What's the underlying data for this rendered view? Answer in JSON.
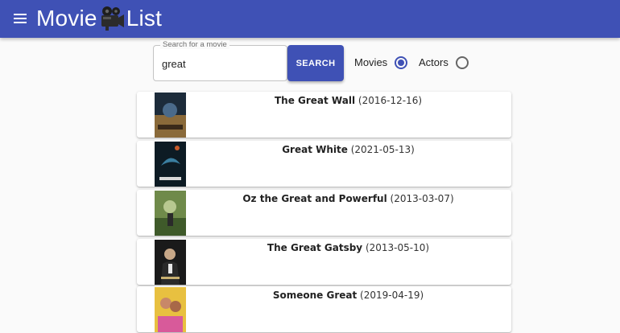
{
  "header": {
    "title_left": "Movie",
    "title_right": "List",
    "camera_icon": "movie-camera-icon",
    "menu_icon": "menu-icon",
    "color": "#3f51b5"
  },
  "search": {
    "legend": "Search for a movie",
    "value": "great",
    "placeholder": "",
    "button_label": "SEARCH"
  },
  "filters": [
    {
      "label": "Movies",
      "selected": true
    },
    {
      "label": "Actors",
      "selected": false
    }
  ],
  "results": [
    {
      "title": "The Great Wall",
      "date": "(2016-12-16)"
    },
    {
      "title": "Great White",
      "date": "(2021-05-13)"
    },
    {
      "title": "Oz the Great and Powerful",
      "date": "(2013-03-07)"
    },
    {
      "title": "The Great Gatsby",
      "date": "(2013-05-10)"
    },
    {
      "title": "Someone Great",
      "date": "(2019-04-19)"
    }
  ]
}
